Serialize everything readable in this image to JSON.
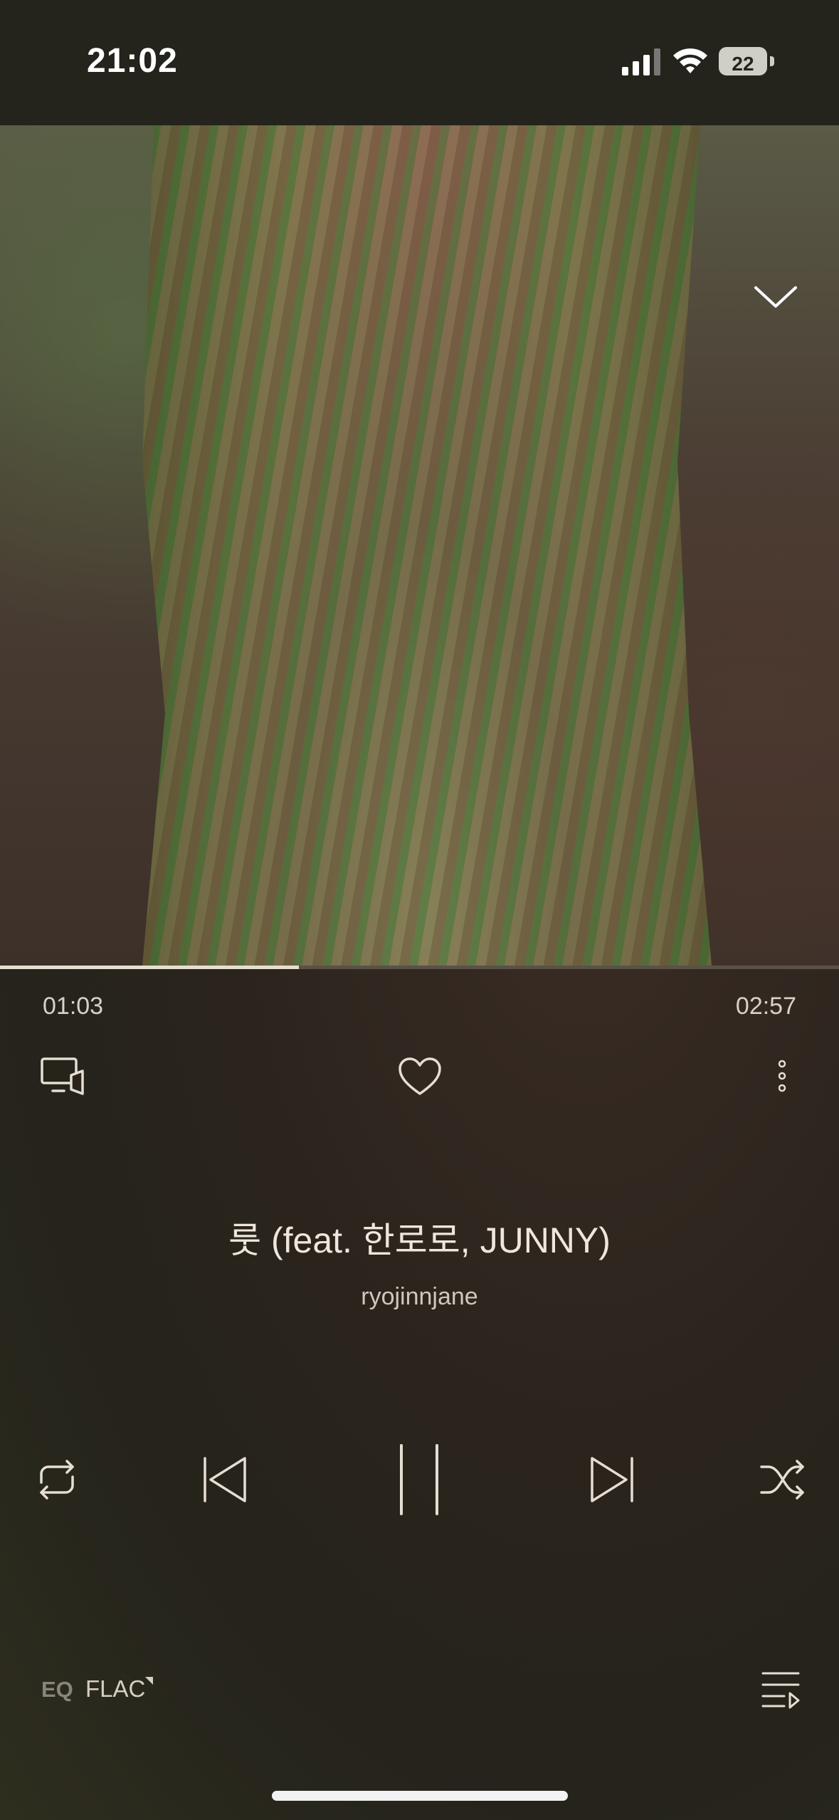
{
  "status_bar": {
    "time": "21:02",
    "battery_level": "22",
    "icons": [
      "signal-icon",
      "wifi-icon",
      "battery-icon"
    ]
  },
  "player": {
    "artwork_icon": "album-artwork",
    "collapse_icon": "chevron-down-icon",
    "progress": {
      "elapsed": "01:03",
      "duration": "02:57",
      "fraction": 0.356
    },
    "actions": [
      "cast-device-icon",
      "heart-icon",
      "more-vertical-icon"
    ],
    "track": {
      "title": "룻 (feat. 한로로, JUNNY)",
      "artist": "ryojinnjane"
    },
    "controls": [
      "repeat-icon",
      "previous-icon",
      "pause-icon",
      "next-icon",
      "shuffle-icon"
    ],
    "footer": {
      "eq_label": "EQ",
      "format_label": "FLAC",
      "queue_icon": "queue-icon"
    }
  },
  "colors": {
    "background": "#2a241d",
    "text_primary": "#efe7dc",
    "text_secondary": "#cfc7bb",
    "progress_fill": "#e6ded2"
  }
}
